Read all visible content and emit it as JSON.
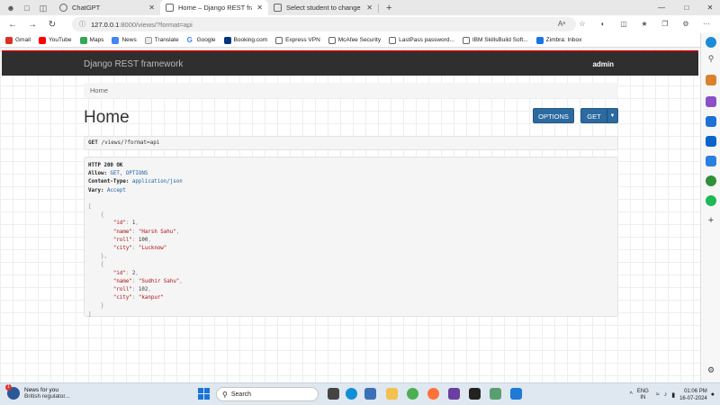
{
  "browser": {
    "tabs": [
      {
        "label": "ChatGPT",
        "active": false
      },
      {
        "label": "Home – Django REST framework",
        "active": true
      },
      {
        "label": "Select student to change | Djang",
        "active": false
      }
    ],
    "url_host": "127.0.0.1",
    "url_path": ":8000/views/?format=api",
    "read_aloud_label": "Aᵃ",
    "bookmarks": [
      "Gmail",
      "YouTube",
      "Maps",
      "News",
      "Translate",
      "Google",
      "Booking.com",
      "Express VPN",
      "McAfee Security",
      "LastPass password...",
      "IBM SkillsBuild Soft...",
      "Zimbra: Inbox"
    ]
  },
  "page": {
    "brand": "Django REST framework",
    "user": "admin",
    "breadcrumb": "Home",
    "title": "Home",
    "options_label": "OPTIONS",
    "get_label": "GET",
    "request": {
      "method": "GET",
      "path": "/views/?format=api"
    },
    "response": {
      "status": "HTTP 200 OK",
      "allow_key": "Allow:",
      "allow_val": "GET, OPTIONS",
      "ctype_key": "Content-Type:",
      "ctype_val": "application/json",
      "vary_key": "Vary:",
      "vary_val": "Accept",
      "records": [
        {
          "id": 1,
          "name": "\"Harsh Sahu\"",
          "roll": 100,
          "city": "\"Lucknow\""
        },
        {
          "id": 2,
          "name": "\"Sudhir Sahu\"",
          "roll": 102,
          "city": "\"kanpur\""
        }
      ]
    }
  },
  "taskbar": {
    "news_title": "News for you",
    "news_sub": "British regulator...",
    "news_badge": "1",
    "search_placeholder": "Search",
    "lang_1": "ENG",
    "lang_2": "IN",
    "time": "01:06 PM",
    "date": "16-07-2024"
  }
}
